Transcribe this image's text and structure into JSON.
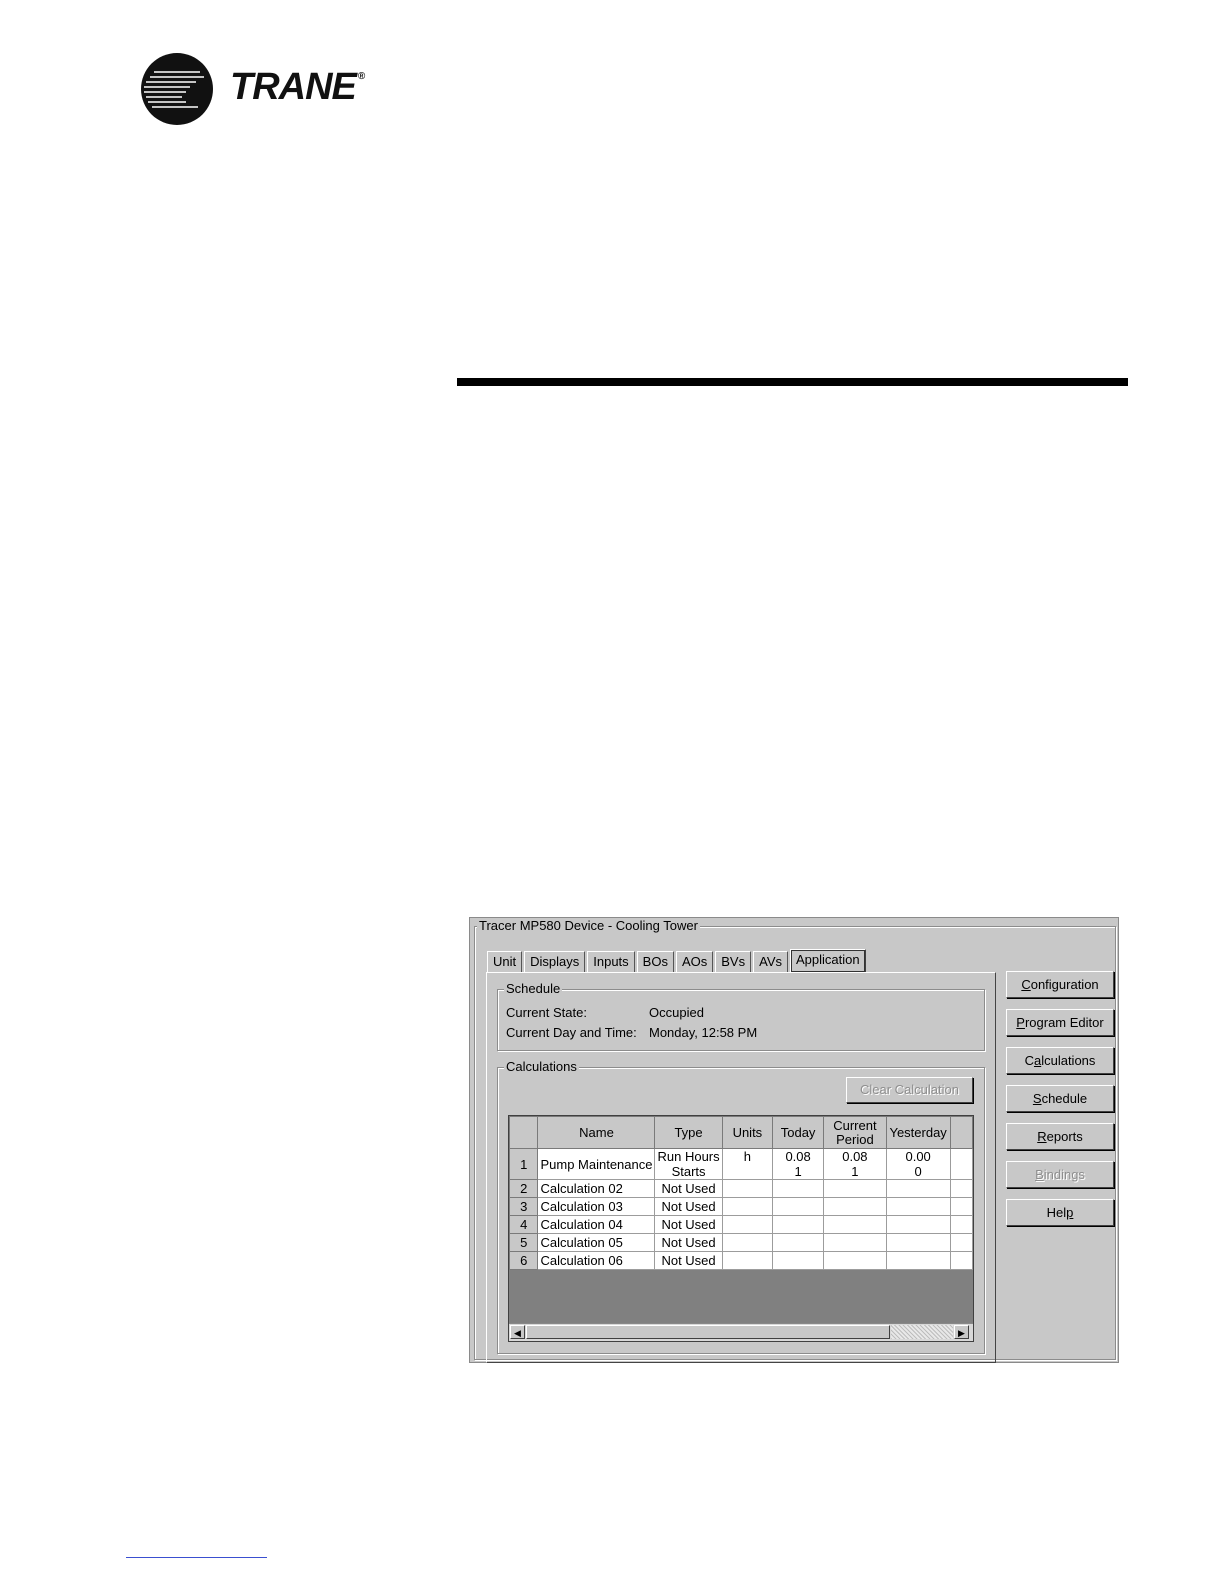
{
  "brand": {
    "name": "TRANE",
    "registered": "®"
  },
  "dialog": {
    "title": "Tracer MP580 Device - Cooling Tower",
    "tabs": [
      {
        "label": "Unit"
      },
      {
        "label": "Displays"
      },
      {
        "label": "Inputs"
      },
      {
        "label": "BOs"
      },
      {
        "label": "AOs"
      },
      {
        "label": "BVs"
      },
      {
        "label": "AVs"
      },
      {
        "label": "Application",
        "active": true
      }
    ],
    "schedule": {
      "title": "Schedule",
      "state_label": "Current State:",
      "state_value": "Occupied",
      "daytime_label": "Current Day and Time:",
      "daytime_value": "Monday, 12:58 PM"
    },
    "calculations": {
      "title": "Calculations",
      "clear_button": "Clear Calculation",
      "columns": [
        "Name",
        "Type",
        "Units",
        "Today",
        "Current Period",
        "Yesterday"
      ],
      "rows": [
        {
          "num": "1",
          "name": "Pump Maintenance",
          "type": [
            "Run Hours",
            "Starts"
          ],
          "units": "h",
          "today": [
            "0.08",
            "1"
          ],
          "current": [
            "0.08",
            "1"
          ],
          "yesterday": [
            "0.00",
            "0"
          ]
        },
        {
          "num": "2",
          "name": "Calculation 02",
          "type": [
            "Not Used"
          ],
          "units": "",
          "today": [],
          "current": [],
          "yesterday": []
        },
        {
          "num": "3",
          "name": "Calculation 03",
          "type": [
            "Not Used"
          ],
          "units": "",
          "today": [],
          "current": [],
          "yesterday": []
        },
        {
          "num": "4",
          "name": "Calculation 04",
          "type": [
            "Not Used"
          ],
          "units": "",
          "today": [],
          "current": [],
          "yesterday": []
        },
        {
          "num": "5",
          "name": "Calculation 05",
          "type": [
            "Not Used"
          ],
          "units": "",
          "today": [],
          "current": [],
          "yesterday": []
        },
        {
          "num": "6",
          "name": "Calculation 06",
          "type": [
            "Not Used"
          ],
          "units": "",
          "today": [],
          "current": [],
          "yesterday": []
        }
      ]
    },
    "side_buttons": [
      {
        "label": "Configuration",
        "key": "C",
        "name": "configuration-button"
      },
      {
        "label": "Program Editor",
        "key": "P",
        "name": "program-editor-button"
      },
      {
        "label": "Calculations",
        "key": "a",
        "name": "calculations-button"
      },
      {
        "label": "Schedule",
        "key": "S",
        "name": "schedule-button"
      },
      {
        "label": "Reports",
        "key": "R",
        "name": "reports-button"
      },
      {
        "label": "Bindings",
        "key": "B",
        "name": "bindings-button",
        "disabled": true
      },
      {
        "label": "Help",
        "key": "p",
        "name": "help-button"
      }
    ]
  }
}
